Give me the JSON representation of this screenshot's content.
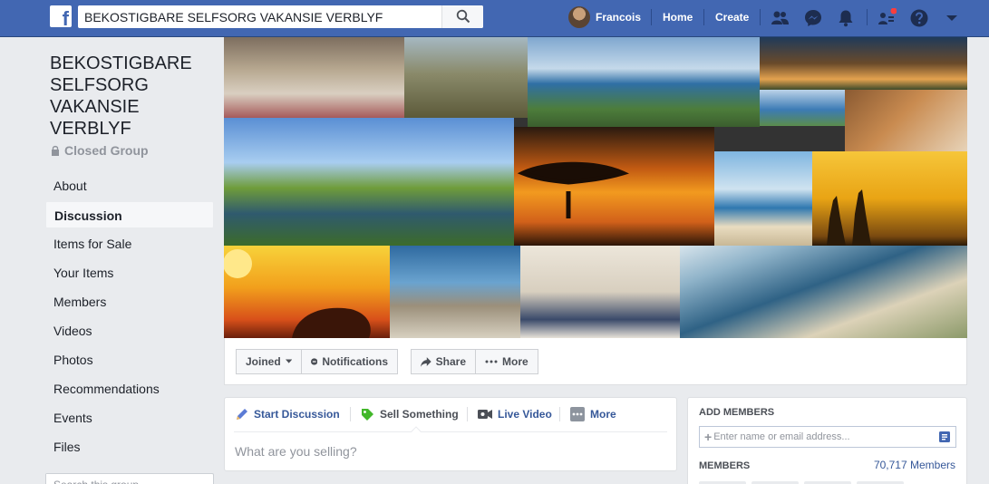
{
  "topbar": {
    "logo": "f",
    "search_value": "BEKOSTIGBARE SELFSORG VAKANSIE VERBLYF",
    "user_name": "Francois",
    "home": "Home",
    "create": "Create",
    "icons": [
      "friends-icon",
      "messenger-icon",
      "bell-icon",
      "group-requests-icon",
      "help-icon",
      "account-menu-icon"
    ],
    "accent": "#4267b2",
    "badge_color": "#fa3e3e"
  },
  "group": {
    "title": "BEKOSTIGBARE SELFSORG VAKANSIE VERBLYF",
    "privacy": "Closed Group"
  },
  "sidebar": {
    "items": [
      {
        "label": "About"
      },
      {
        "label": "Discussion"
      },
      {
        "label": "Items for Sale"
      },
      {
        "label": "Your Items"
      },
      {
        "label": "Members"
      },
      {
        "label": "Videos"
      },
      {
        "label": "Photos"
      },
      {
        "label": "Recommendations"
      },
      {
        "label": "Events"
      },
      {
        "label": "Files"
      }
    ],
    "active": "Discussion",
    "search_placeholder": "Search this group"
  },
  "actions": {
    "joined": "Joined",
    "notifications": "Notifications",
    "share": "Share",
    "more": "More"
  },
  "composer": {
    "tabs": [
      {
        "label": "Start Discussion"
      },
      {
        "label": "Sell Something"
      },
      {
        "label": "Live Video"
      },
      {
        "label": "More"
      }
    ],
    "active_tab": "Sell Something",
    "placeholder": "What are you selling?"
  },
  "add_members": {
    "header": "ADD MEMBERS",
    "input_placeholder": "Enter name or email address...",
    "members_label": "MEMBERS",
    "members_count": "70,717 Members"
  }
}
